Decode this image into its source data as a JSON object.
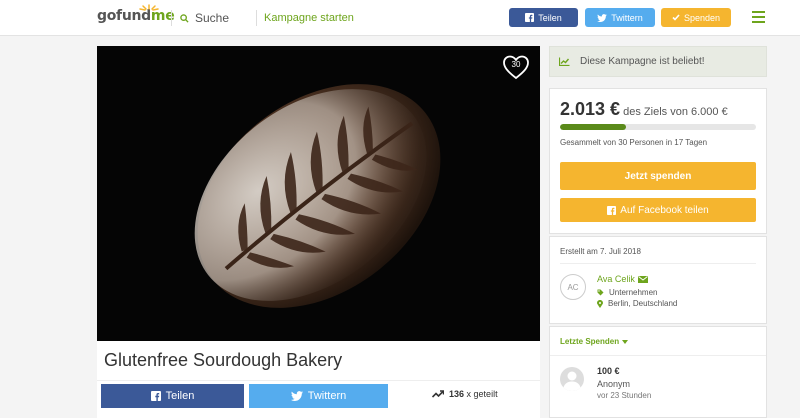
{
  "header": {
    "logo_go": "go",
    "logo_fund": "fund",
    "logo_me": "me",
    "search_label": "Suche",
    "start_label": "Kampagne starten",
    "facebook_label": "Teilen",
    "twitter_label": "Twittern",
    "donate_label": "Spenden"
  },
  "campaign": {
    "likes": "30",
    "title": "Glutenfree Sourdough Bakery",
    "share_facebook": "Teilen",
    "share_twitter": "Twittern",
    "shared_count": "136",
    "shared_suffix": "x geteilt"
  },
  "sidebar": {
    "popular_text": "Diese Kampagne ist beliebt!",
    "raised_amount": "2.013 €",
    "goal_text": "des Ziels von 6.000 €",
    "progress_fraction": 0.3355,
    "raised_meta": "Gesammelt von 30 Personen in 17 Tagen",
    "donate_now": "Jetzt spenden",
    "facebook_share": "Auf Facebook teilen",
    "created": "Erstellt am 7. Juli 2018",
    "organizer_initials": "AC",
    "organizer_name": "Ava Celik",
    "organizer_type": "Unternehmen",
    "organizer_location": "Berlin, Deutschland",
    "donations_header": "Letzte Spenden",
    "donation_amount": "100 €",
    "donation_name": "Anonym",
    "donation_time": "vor 23 Stunden"
  },
  "colors": {
    "brand_green": "#6ea51d",
    "facebook": "#3b5998",
    "twitter": "#55acee",
    "donate": "#f5b52f"
  }
}
